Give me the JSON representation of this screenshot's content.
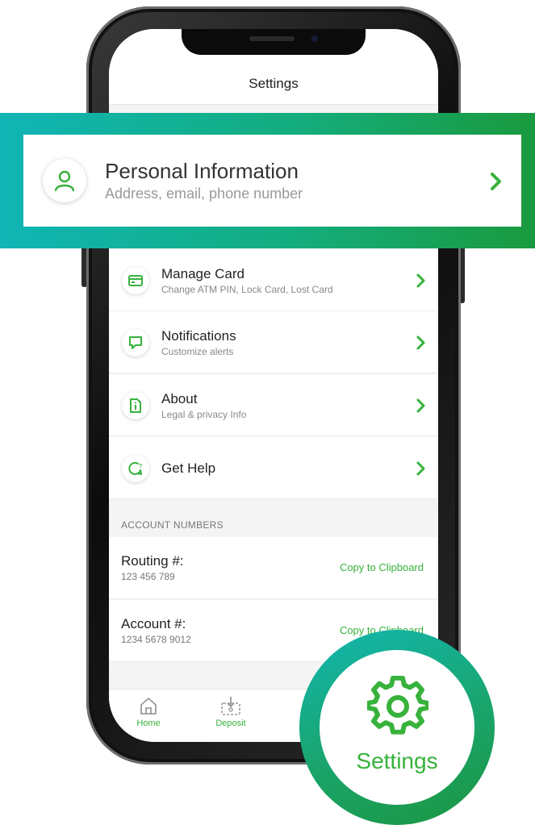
{
  "header": {
    "title": "Settings"
  },
  "highlight": {
    "title": "Personal Information",
    "subtitle": "Address, email, phone number",
    "icon": "person-icon"
  },
  "settings_rows": [
    {
      "title": "Manage Card",
      "subtitle": "Change ATM PIN, Lock Card, Lost Card",
      "icon": "card-icon"
    },
    {
      "title": "Notifications",
      "subtitle": "Customize alerts",
      "icon": "chat-bubble-icon"
    },
    {
      "title": "About",
      "subtitle": "Legal & privacy Info",
      "icon": "info-document-icon"
    },
    {
      "title": "Get Help",
      "subtitle": "",
      "icon": "help-bubble-icon"
    }
  ],
  "account_numbers": {
    "section_label": "ACCOUNT NUMBERS",
    "rows": [
      {
        "label": "Routing #:",
        "number": "123 456 789",
        "action": "Copy to Clipboard"
      },
      {
        "label": "Account #:",
        "number": "1234 5678 9012",
        "action": "Copy to Clipboard"
      }
    ]
  },
  "tabbar": {
    "tabs": [
      {
        "label": "Home",
        "icon": "home-icon"
      },
      {
        "label": "Deposit",
        "icon": "deposit-icon"
      }
    ]
  },
  "callout": {
    "label": "Settings",
    "icon": "gear-icon"
  },
  "colors": {
    "accent_green": "#37b23b",
    "teal": "#10b5b5",
    "dark_green": "#1a9a3e"
  }
}
